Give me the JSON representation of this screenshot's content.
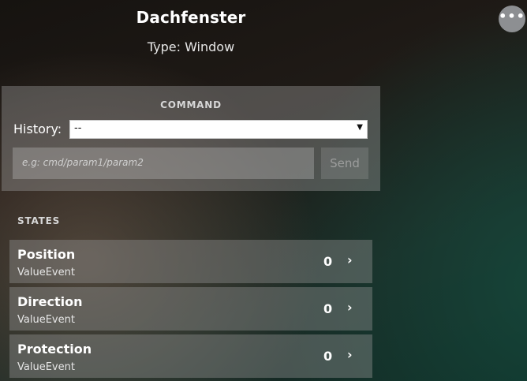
{
  "header": {
    "title": "Dachfenster",
    "subtitle": "Type: Window",
    "more_icon": "more-horizontal-icon"
  },
  "command": {
    "title": "COMMAND",
    "history_label": "History:",
    "history_selected": "--",
    "input_placeholder": "e.g: cmd/param1/param2",
    "send_label": "Send"
  },
  "states": {
    "title": "STATES",
    "items": [
      {
        "name": "Position",
        "type": "ValueEvent",
        "value": "0"
      },
      {
        "name": "Direction",
        "type": "ValueEvent",
        "value": "0"
      },
      {
        "name": "Protection",
        "type": "ValueEvent",
        "value": "0"
      }
    ]
  },
  "colors": {
    "panel_bg": "#969696",
    "more_button_bg": "#8d8f92",
    "text": "#ffffff"
  }
}
